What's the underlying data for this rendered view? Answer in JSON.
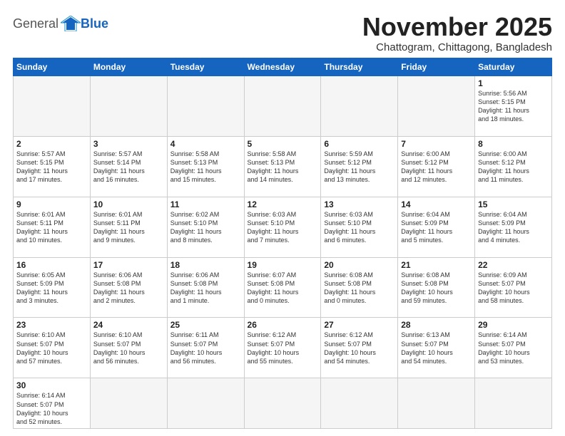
{
  "logo": {
    "general": "General",
    "blue": "Blue"
  },
  "header": {
    "month_title": "November 2025",
    "location": "Chattogram, Chittagong, Bangladesh"
  },
  "weekdays": [
    "Sunday",
    "Monday",
    "Tuesday",
    "Wednesday",
    "Thursday",
    "Friday",
    "Saturday"
  ],
  "weeks": [
    [
      {
        "day": "",
        "empty": true
      },
      {
        "day": "",
        "empty": true
      },
      {
        "day": "",
        "empty": true
      },
      {
        "day": "",
        "empty": true
      },
      {
        "day": "",
        "empty": true
      },
      {
        "day": "",
        "empty": true
      },
      {
        "day": "1",
        "info": "Sunrise: 5:56 AM\nSunset: 5:15 PM\nDaylight: 11 hours\nand 18 minutes."
      }
    ],
    [
      {
        "day": "2",
        "info": "Sunrise: 5:57 AM\nSunset: 5:15 PM\nDaylight: 11 hours\nand 17 minutes."
      },
      {
        "day": "3",
        "info": "Sunrise: 5:57 AM\nSunset: 5:14 PM\nDaylight: 11 hours\nand 16 minutes."
      },
      {
        "day": "4",
        "info": "Sunrise: 5:58 AM\nSunset: 5:13 PM\nDaylight: 11 hours\nand 15 minutes."
      },
      {
        "day": "5",
        "info": "Sunrise: 5:58 AM\nSunset: 5:13 PM\nDaylight: 11 hours\nand 14 minutes."
      },
      {
        "day": "6",
        "info": "Sunrise: 5:59 AM\nSunset: 5:12 PM\nDaylight: 11 hours\nand 13 minutes."
      },
      {
        "day": "7",
        "info": "Sunrise: 6:00 AM\nSunset: 5:12 PM\nDaylight: 11 hours\nand 12 minutes."
      },
      {
        "day": "8",
        "info": "Sunrise: 6:00 AM\nSunset: 5:12 PM\nDaylight: 11 hours\nand 11 minutes."
      }
    ],
    [
      {
        "day": "9",
        "info": "Sunrise: 6:01 AM\nSunset: 5:11 PM\nDaylight: 11 hours\nand 10 minutes."
      },
      {
        "day": "10",
        "info": "Sunrise: 6:01 AM\nSunset: 5:11 PM\nDaylight: 11 hours\nand 9 minutes."
      },
      {
        "day": "11",
        "info": "Sunrise: 6:02 AM\nSunset: 5:10 PM\nDaylight: 11 hours\nand 8 minutes."
      },
      {
        "day": "12",
        "info": "Sunrise: 6:03 AM\nSunset: 5:10 PM\nDaylight: 11 hours\nand 7 minutes."
      },
      {
        "day": "13",
        "info": "Sunrise: 6:03 AM\nSunset: 5:10 PM\nDaylight: 11 hours\nand 6 minutes."
      },
      {
        "day": "14",
        "info": "Sunrise: 6:04 AM\nSunset: 5:09 PM\nDaylight: 11 hours\nand 5 minutes."
      },
      {
        "day": "15",
        "info": "Sunrise: 6:04 AM\nSunset: 5:09 PM\nDaylight: 11 hours\nand 4 minutes."
      }
    ],
    [
      {
        "day": "16",
        "info": "Sunrise: 6:05 AM\nSunset: 5:09 PM\nDaylight: 11 hours\nand 3 minutes."
      },
      {
        "day": "17",
        "info": "Sunrise: 6:06 AM\nSunset: 5:08 PM\nDaylight: 11 hours\nand 2 minutes."
      },
      {
        "day": "18",
        "info": "Sunrise: 6:06 AM\nSunset: 5:08 PM\nDaylight: 11 hours\nand 1 minute."
      },
      {
        "day": "19",
        "info": "Sunrise: 6:07 AM\nSunset: 5:08 PM\nDaylight: 11 hours\nand 0 minutes."
      },
      {
        "day": "20",
        "info": "Sunrise: 6:08 AM\nSunset: 5:08 PM\nDaylight: 11 hours\nand 0 minutes."
      },
      {
        "day": "21",
        "info": "Sunrise: 6:08 AM\nSunset: 5:08 PM\nDaylight: 10 hours\nand 59 minutes."
      },
      {
        "day": "22",
        "info": "Sunrise: 6:09 AM\nSunset: 5:07 PM\nDaylight: 10 hours\nand 58 minutes."
      }
    ],
    [
      {
        "day": "23",
        "info": "Sunrise: 6:10 AM\nSunset: 5:07 PM\nDaylight: 10 hours\nand 57 minutes."
      },
      {
        "day": "24",
        "info": "Sunrise: 6:10 AM\nSunset: 5:07 PM\nDaylight: 10 hours\nand 56 minutes."
      },
      {
        "day": "25",
        "info": "Sunrise: 6:11 AM\nSunset: 5:07 PM\nDaylight: 10 hours\nand 56 minutes."
      },
      {
        "day": "26",
        "info": "Sunrise: 6:12 AM\nSunset: 5:07 PM\nDaylight: 10 hours\nand 55 minutes."
      },
      {
        "day": "27",
        "info": "Sunrise: 6:12 AM\nSunset: 5:07 PM\nDaylight: 10 hours\nand 54 minutes."
      },
      {
        "day": "28",
        "info": "Sunrise: 6:13 AM\nSunset: 5:07 PM\nDaylight: 10 hours\nand 54 minutes."
      },
      {
        "day": "29",
        "info": "Sunrise: 6:14 AM\nSunset: 5:07 PM\nDaylight: 10 hours\nand 53 minutes."
      }
    ],
    [
      {
        "day": "30",
        "info": "Sunrise: 6:14 AM\nSunset: 5:07 PM\nDaylight: 10 hours\nand 52 minutes."
      },
      {
        "day": "",
        "empty": true
      },
      {
        "day": "",
        "empty": true
      },
      {
        "day": "",
        "empty": true
      },
      {
        "day": "",
        "empty": true
      },
      {
        "day": "",
        "empty": true
      },
      {
        "day": "",
        "empty": true
      }
    ]
  ]
}
